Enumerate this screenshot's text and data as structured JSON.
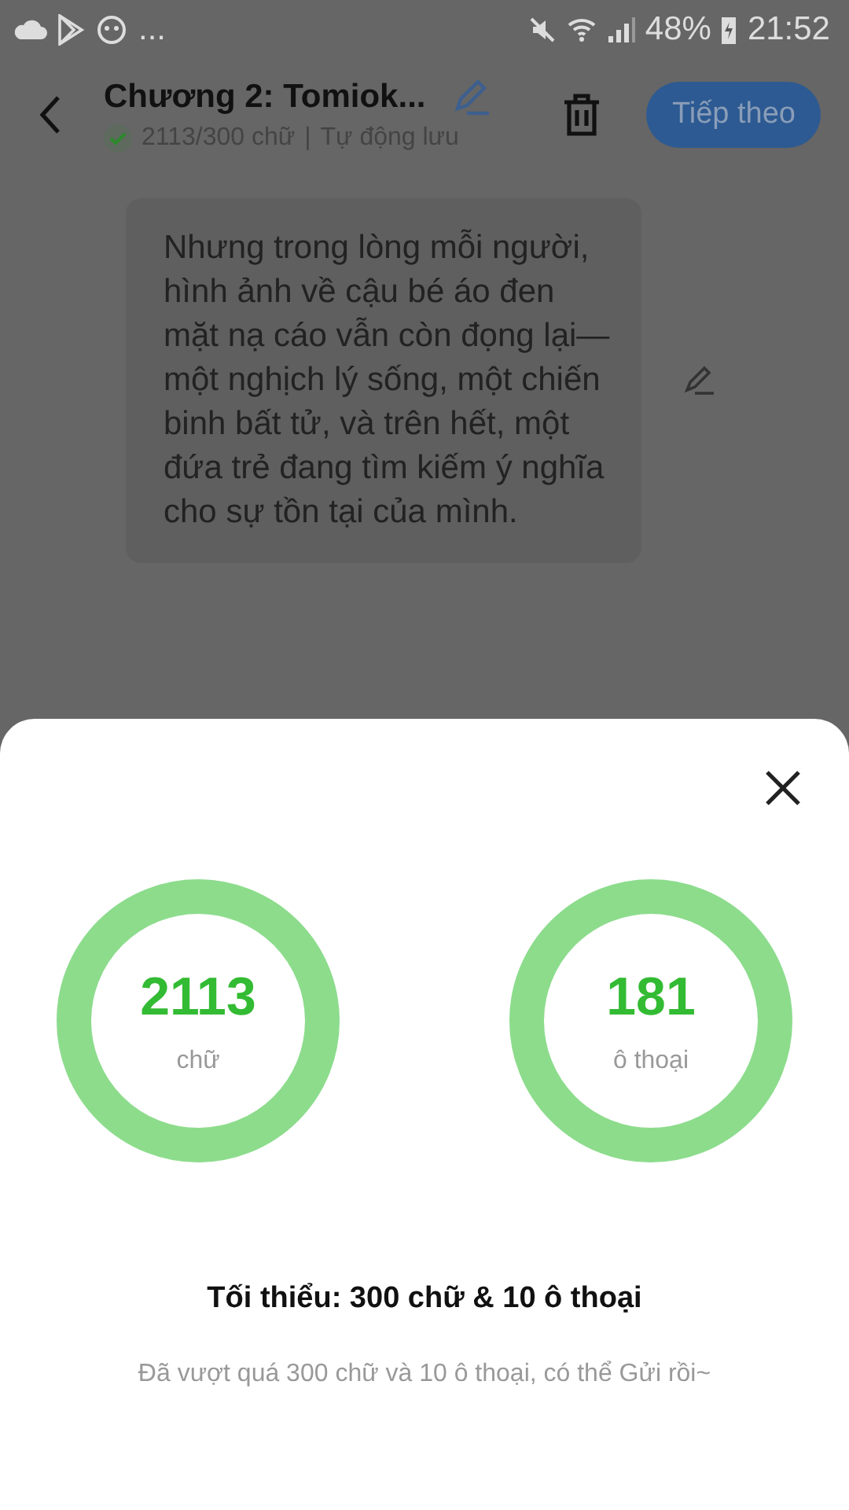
{
  "status_bar": {
    "more": "...",
    "battery": "48%",
    "time": "21:52"
  },
  "header": {
    "title": "Chương 2: Tomiok...",
    "saved": true,
    "word_count": "2113/300 chữ",
    "separator": "|",
    "autosave": "Tự động lưu",
    "next_button": "Tiếp theo"
  },
  "paragraph": {
    "text": "Nhưng trong lòng mỗi người, hình ảnh về cậu bé áo đen mặt nạ cáo vẫn còn đọng lại—một nghịch lý sống, một chiến binh bất tử, và trên hết, một đứa trẻ đang tìm kiếm ý nghĩa cho sự tồn tại của mình."
  },
  "sheet": {
    "rings": [
      {
        "value": "2113",
        "unit": "chữ",
        "level": 1
      },
      {
        "value": "181",
        "unit": "ô thoại",
        "level": 1
      }
    ],
    "requirement": "Tối thiểu: 300 chữ & 10 ô thoại",
    "message": "Đã vượt quá 300 chữ và 10 ô thoại, có thể Gửi rồi~"
  }
}
